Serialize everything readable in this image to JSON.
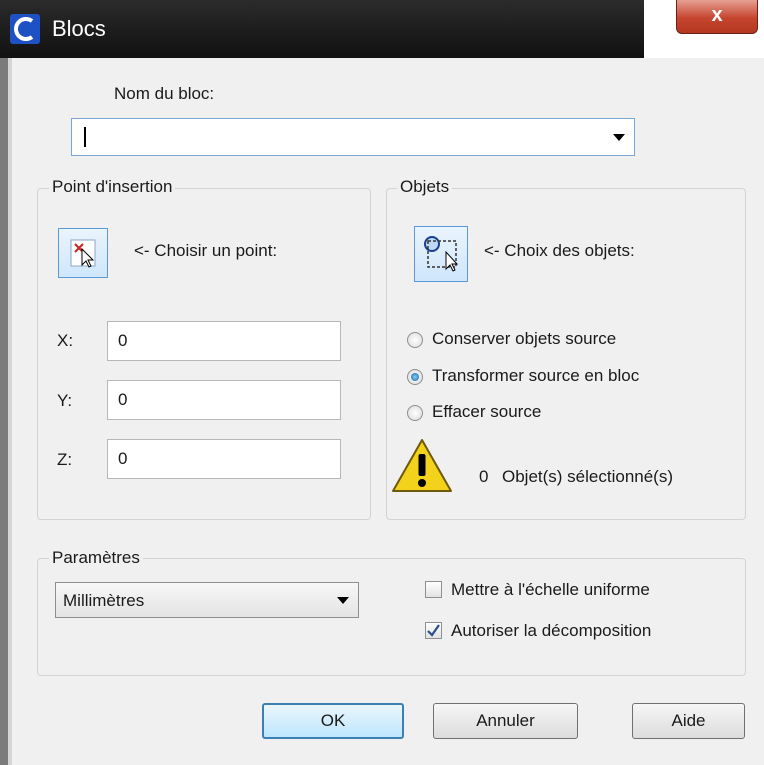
{
  "window": {
    "title": "Blocs",
    "close_label": "x"
  },
  "block_name": {
    "label": "Nom du bloc:",
    "value": ""
  },
  "insertion_point": {
    "group_title": "Point d'insertion",
    "pick_label": "<- Choisir un point:",
    "x_label": "X:",
    "x_value": "0",
    "y_label": "Y:",
    "y_value": "0",
    "z_label": "Z:",
    "z_value": "0"
  },
  "objects": {
    "group_title": "Objets",
    "select_label": "<- Choix des objets:",
    "radios": [
      {
        "label": "Conserver objets source",
        "selected": false
      },
      {
        "label": "Transformer source en bloc",
        "selected": true
      },
      {
        "label": "Effacer source",
        "selected": false
      }
    ],
    "selected_count": "0",
    "selected_text": "Objet(s) sélectionné(s)"
  },
  "settings": {
    "group_title": "Paramètres",
    "unit_value": "Millimètres",
    "checkboxes": [
      {
        "label": "Mettre à l'échelle uniforme",
        "checked": false
      },
      {
        "label": "Autoriser la décomposition",
        "checked": true
      }
    ]
  },
  "buttons": {
    "ok": "OK",
    "cancel": "Annuler",
    "help": "Aide"
  },
  "colors": {
    "accent": "#3c7fb1",
    "title_bar": "#1a1a1a",
    "warning": "#f3d21c"
  }
}
